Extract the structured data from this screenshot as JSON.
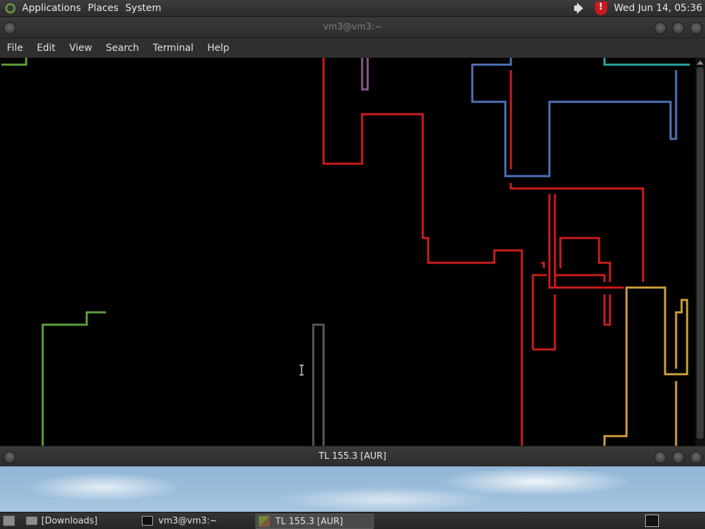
{
  "top_panel": {
    "menus": [
      "Applications",
      "Places",
      "System"
    ],
    "clock": "Wed Jun 14, 05:36"
  },
  "terminal_window": {
    "title": "vm3@vm3:~",
    "menu": [
      "File",
      "Edit",
      "View",
      "Search",
      "Terminal",
      "Help"
    ],
    "background": "#000000",
    "trail_colors": [
      "#d01c1c",
      "#4f74b8",
      "#5ea33a",
      "#d0a23a",
      "#2aa7a7",
      "#8a5a8a",
      "#5a5a5a"
    ]
  },
  "second_window": {
    "title": "TL 155.3 [AUR]"
  },
  "taskbar": {
    "tasks": [
      {
        "label": "[Downloads]",
        "icon": "folder-icon",
        "active": false
      },
      {
        "label": "vm3@vm3:~",
        "icon": "terminal-icon",
        "active": false
      },
      {
        "label": "TL 155.3 [AUR]",
        "icon": "cube-icon",
        "active": true
      }
    ]
  }
}
